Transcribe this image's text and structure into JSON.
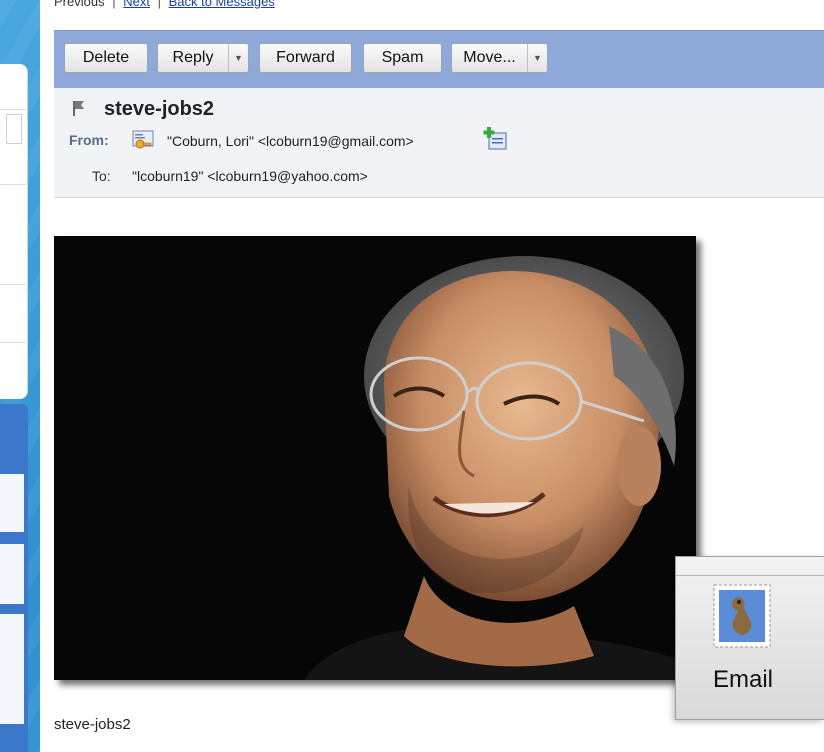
{
  "nav": {
    "previous": "Previous",
    "next": "Next",
    "back": "Back to Messages",
    "separator": "|"
  },
  "toolbar": {
    "delete_label": "Delete",
    "reply_label": "Reply",
    "forward_label": "Forward",
    "spam_label": "Spam",
    "move_label": "Move..."
  },
  "message": {
    "subject": "steve-jobs2",
    "from_label": "From:",
    "from_value": "\"Coburn, Lori\" <lcoburn19@gmail.com>",
    "to_label": "To:",
    "to_value": "\"lcoburn19\" <lcoburn19@yahoo.com>",
    "attachment_caption": "steve-jobs2"
  },
  "dock": {
    "email_label": "Email"
  },
  "icons": {
    "flag": "flag-icon",
    "contact_card": "contact-card-icon",
    "add_contact": "add-contact-icon",
    "email_app": "postage-stamp-icon"
  },
  "colors": {
    "toolbar_bg": "#8fa9d8",
    "header_bg": "#f1f3f6",
    "link": "#1b3f9e",
    "slide_bg": "#3a9ad8"
  }
}
